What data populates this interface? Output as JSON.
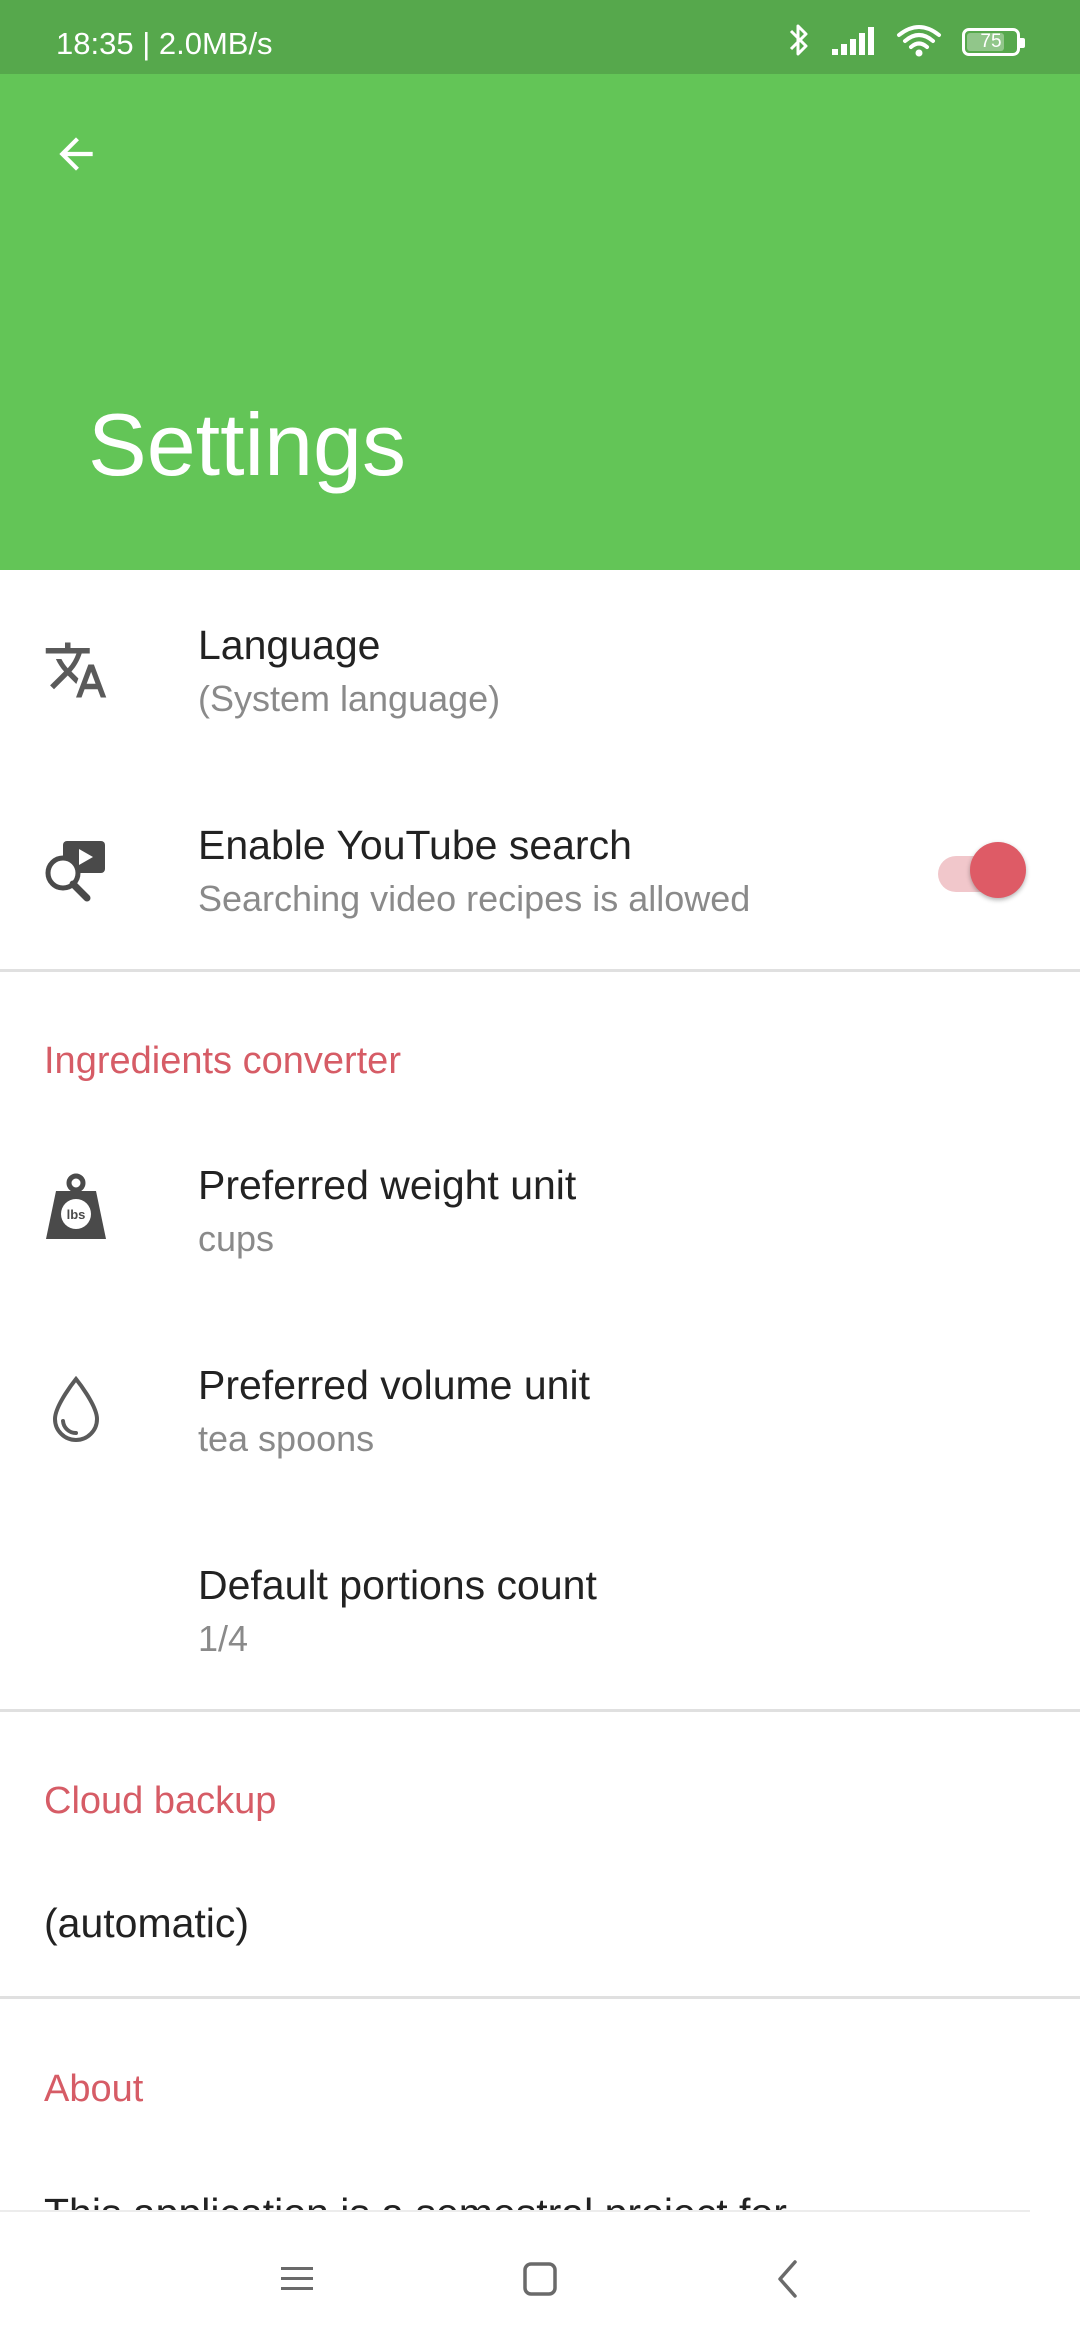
{
  "status_bar": {
    "time_speed": "18:35 | 2.0MB/s",
    "battery": "75"
  },
  "app_bar": {
    "title": "Settings"
  },
  "general": {
    "language": {
      "title": "Language",
      "subtitle": "(System language)"
    },
    "youtube": {
      "title": "Enable YouTube search",
      "subtitle": "Searching video recipes is allowed",
      "enabled": true
    }
  },
  "ingredients_converter": {
    "header": "Ingredients converter",
    "weight": {
      "title": "Preferred weight unit",
      "subtitle": "cups"
    },
    "volume": {
      "title": "Preferred volume unit",
      "subtitle": "tea spoons"
    },
    "portions": {
      "title": "Default portions count",
      "subtitle": "1/4"
    }
  },
  "cloud_backup": {
    "header": "Cloud backup",
    "value": "(automatic)"
  },
  "about": {
    "header": "About",
    "text": "This application is a semestral project for"
  },
  "colors": {
    "status_bar": "#56a84c",
    "app_bar": "#63c557",
    "accent": "#d65c66"
  }
}
